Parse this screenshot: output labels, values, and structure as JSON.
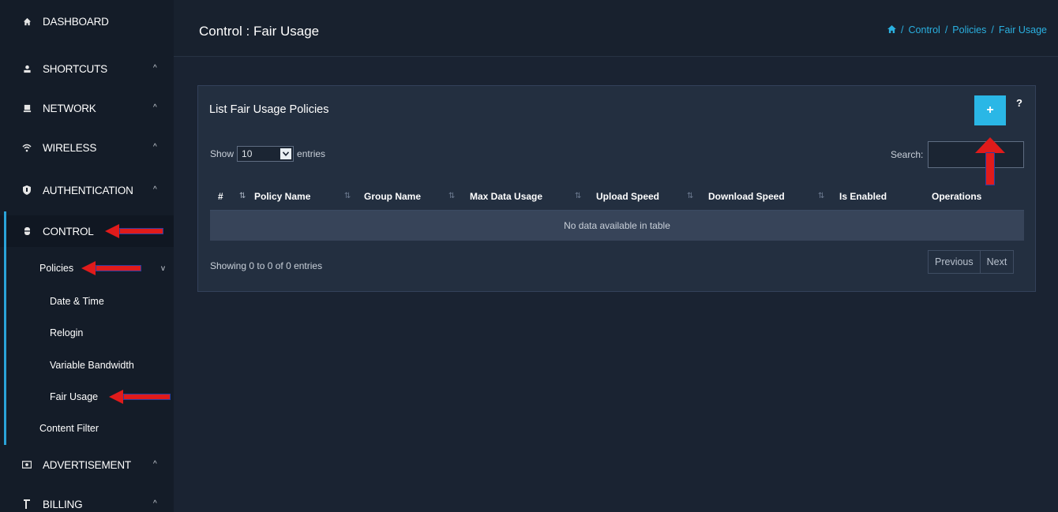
{
  "sidebar": {
    "items": [
      {
        "label": "DASHBOARD",
        "icon": "home-icon"
      },
      {
        "label": "SHORTCUTS",
        "icon": "user-icon",
        "chevron": "^"
      },
      {
        "label": "NETWORK",
        "icon": "monitor-icon",
        "chevron": "^"
      },
      {
        "label": "WIRELESS",
        "icon": "wifi-icon",
        "chevron": "^"
      },
      {
        "label": "AUTHENTICATION",
        "icon": "shield-icon",
        "chevron": "^"
      },
      {
        "label": "CONTROL",
        "icon": "bug-icon"
      },
      {
        "label": "ADVERTISEMENT",
        "icon": "money-icon",
        "chevron": "^"
      },
      {
        "label": "BILLING",
        "icon": "receipt-icon",
        "chevron": "^"
      }
    ],
    "control_sub": {
      "policies": {
        "label": "Policies",
        "chevron": "v"
      },
      "policy_items": [
        "Date & Time",
        "Relogin",
        "Variable Bandwidth",
        "Fair Usage"
      ],
      "content_filter": "Content Filter"
    }
  },
  "header": {
    "title": "Control : Fair Usage",
    "breadcrumb": [
      "Control",
      "Policies",
      "Fair Usage"
    ],
    "breadcrumb_sep": "/"
  },
  "panel": {
    "title": "List Fair Usage Policies",
    "add_label": "+",
    "help_label": "?",
    "show_label": "Show",
    "entries_value": "10",
    "entries_label": "entries",
    "search_label": "Search:",
    "search_value": "",
    "columns": [
      "#",
      "Policy Name",
      "Group Name",
      "Max Data Usage",
      "Upload Speed",
      "Download Speed",
      "Is Enabled",
      "Operations"
    ],
    "empty_text": "No data available in table",
    "info_text": "Showing 0 to 0 of 0 entries",
    "prev_label": "Previous",
    "next_label": "Next"
  },
  "colors": {
    "accent": "#2ab7e6",
    "annotation_arrow": "#e01b1b",
    "background": "#1a2332",
    "panel": "#232f40"
  }
}
